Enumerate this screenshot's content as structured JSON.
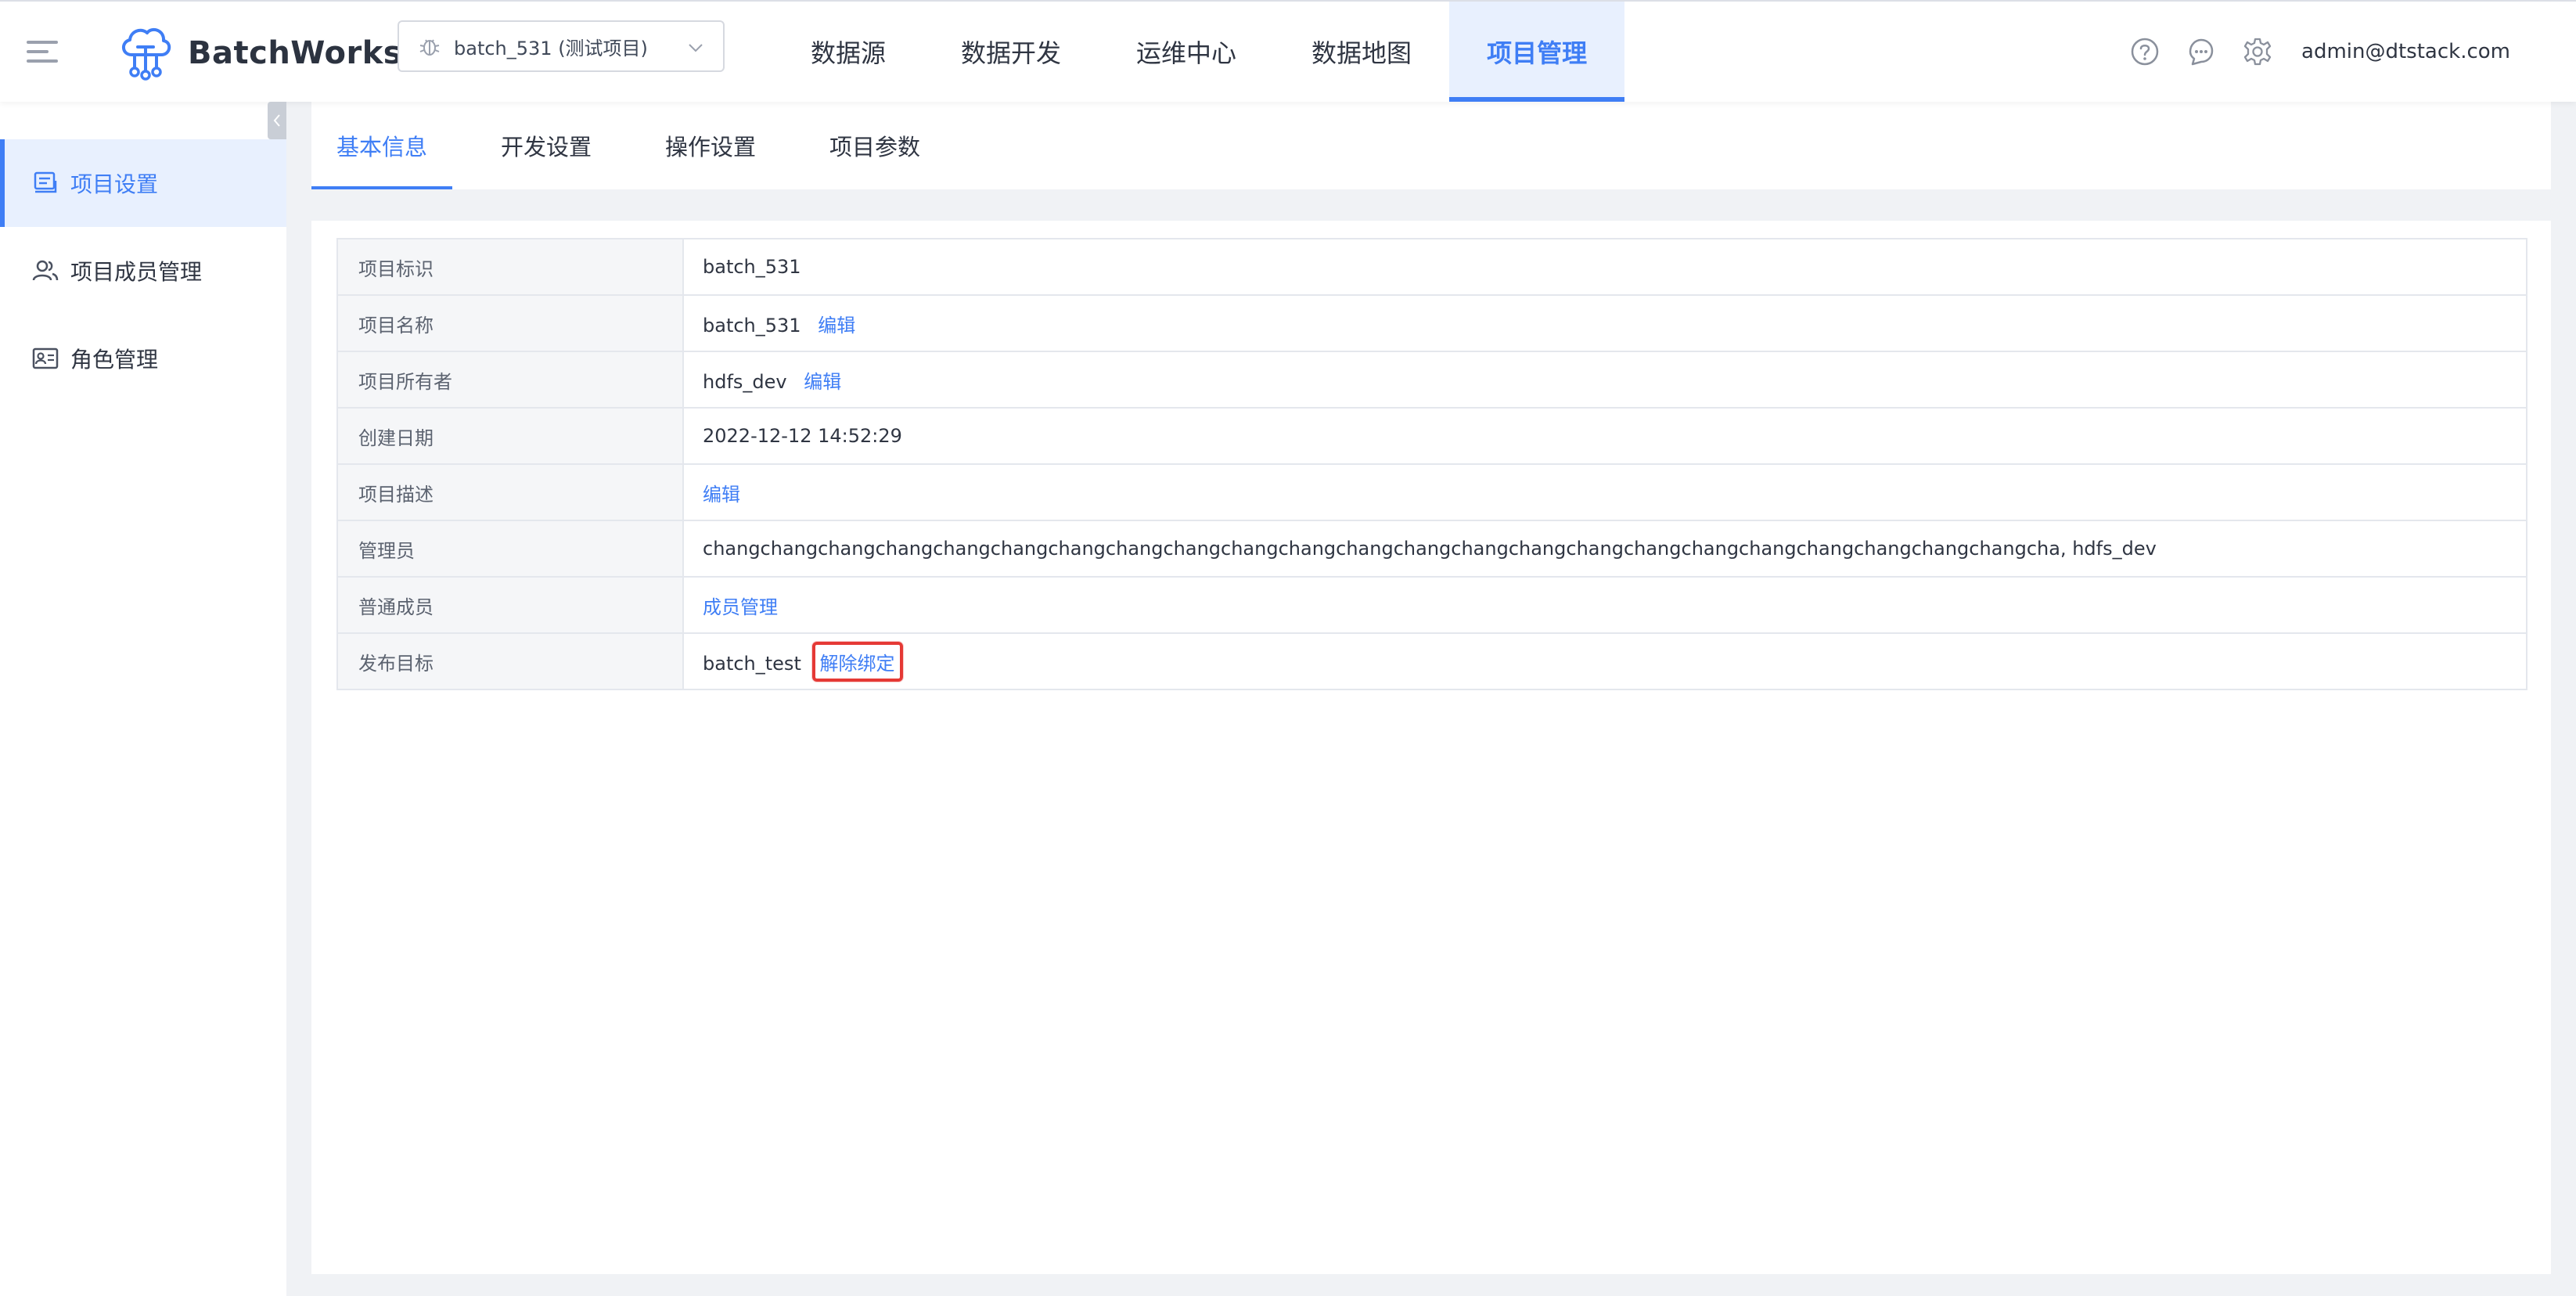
{
  "header": {
    "app_name": "BatchWorks",
    "project_select": "batch_531 (测试项目)",
    "nav": [
      {
        "label": "数据源",
        "active": false
      },
      {
        "label": "数据开发",
        "active": false
      },
      {
        "label": "运维中心",
        "active": false
      },
      {
        "label": "数据地图",
        "active": false
      },
      {
        "label": "项目管理",
        "active": true
      }
    ],
    "user": "admin@dtstack.com"
  },
  "sidebar": {
    "items": [
      {
        "label": "项目设置",
        "icon": "settings-box-icon",
        "active": true
      },
      {
        "label": "项目成员管理",
        "icon": "users-icon",
        "active": false
      },
      {
        "label": "角色管理",
        "icon": "id-card-icon",
        "active": false
      }
    ]
  },
  "tabs": [
    {
      "label": "基本信息",
      "active": true
    },
    {
      "label": "开发设置",
      "active": false
    },
    {
      "label": "操作设置",
      "active": false
    },
    {
      "label": "项目参数",
      "active": false
    }
  ],
  "info": {
    "project_id": {
      "label": "项目标识",
      "value": "batch_531"
    },
    "project_name": {
      "label": "项目名称",
      "value": "batch_531",
      "action": "编辑"
    },
    "owner": {
      "label": "项目所有者",
      "value": "hdfs_dev",
      "action": "编辑"
    },
    "created": {
      "label": "创建日期",
      "value": "2022-12-12 14:52:29"
    },
    "description": {
      "label": "项目描述",
      "action": "编辑"
    },
    "admins": {
      "label": "管理员",
      "value": "changchangchangchangchangchangchangchangchangchangchangchangchangchangchangchangchangchangchangchangchangchangchangcha, hdfs_dev"
    },
    "members": {
      "label": "普通成员",
      "action": "成员管理"
    },
    "publish_target": {
      "label": "发布目标",
      "value": "batch_test",
      "action": "解除绑定"
    }
  },
  "colors": {
    "accent": "#3f7ef5",
    "highlight_border": "#e53935"
  }
}
